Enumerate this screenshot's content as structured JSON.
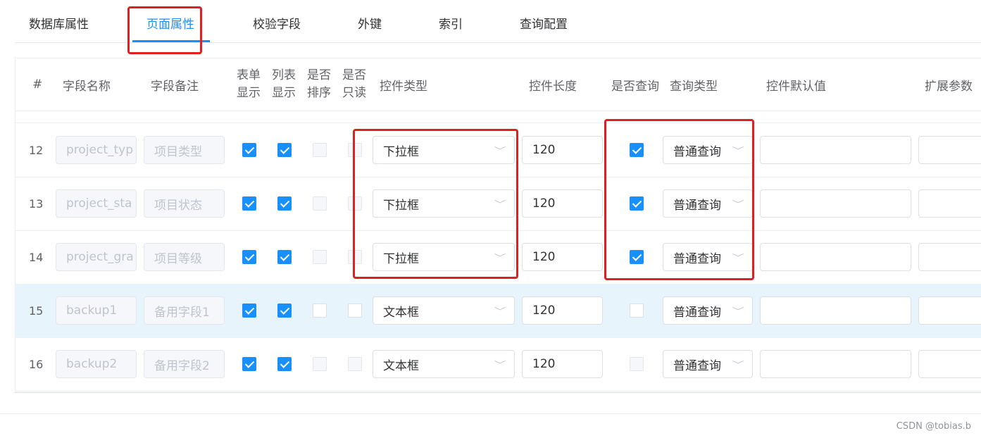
{
  "tabs": [
    {
      "label": "数据库属性",
      "active": false
    },
    {
      "label": "页面属性",
      "active": true
    },
    {
      "label": "校验字段",
      "active": false
    },
    {
      "label": "外键",
      "active": false
    },
    {
      "label": "索引",
      "active": false
    },
    {
      "label": "查询配置",
      "active": false
    }
  ],
  "table": {
    "headers": {
      "index": "#",
      "field_name": "字段名称",
      "field_remark": "字段备注",
      "form_show_1": "表单",
      "form_show_2": "显示",
      "list_show_1": "列表",
      "list_show_2": "显示",
      "sortable_1": "是否",
      "sortable_2": "排序",
      "readonly_1": "是否",
      "readonly_2": "只读",
      "control_type": "控件类型",
      "control_length": "控件长度",
      "is_query": "是否查询",
      "query_type": "查询类型",
      "default_value": "控件默认值",
      "ext_params": "扩展参数"
    },
    "rows": [
      {
        "index": "12",
        "field_name": "project_typ",
        "field_remark": "项目类型",
        "form_show": true,
        "list_show": true,
        "sortable": false,
        "readonly": false,
        "control_type": "下拉框",
        "control_length": "120",
        "is_query": true,
        "query_type": "普通查询",
        "default_value": "",
        "ext_params": ""
      },
      {
        "index": "13",
        "field_name": "project_sta",
        "field_remark": "项目状态",
        "form_show": true,
        "list_show": true,
        "sortable": false,
        "readonly": false,
        "control_type": "下拉框",
        "control_length": "120",
        "is_query": true,
        "query_type": "普通查询",
        "default_value": "",
        "ext_params": ""
      },
      {
        "index": "14",
        "field_name": "project_gra",
        "field_remark": "项目等级",
        "form_show": true,
        "list_show": true,
        "sortable": false,
        "readonly": false,
        "control_type": "下拉框",
        "control_length": "120",
        "is_query": true,
        "query_type": "普通查询",
        "default_value": "",
        "ext_params": ""
      },
      {
        "index": "15",
        "field_name": "backup1",
        "field_remark": "备用字段1",
        "form_show": true,
        "list_show": true,
        "sortable": false,
        "readonly": false,
        "control_type": "文本框",
        "control_length": "120",
        "is_query": false,
        "query_type": "普通查询",
        "default_value": "",
        "ext_params": ""
      },
      {
        "index": "16",
        "field_name": "backup2",
        "field_remark": "备用字段2",
        "form_show": true,
        "list_show": true,
        "sortable": false,
        "readonly": false,
        "control_type": "文本框",
        "control_length": "120",
        "is_query": false,
        "query_type": "普通查询",
        "default_value": "",
        "ext_params": ""
      }
    ]
  },
  "colors": {
    "accent": "#1890ff",
    "annotation": "#e02020",
    "row_highlight": "#e8f4fb"
  },
  "icons": {
    "select_arrow": "chevron-down-icon",
    "checked": "checkmark-icon"
  },
  "watermark": "CSDN @tobias.b"
}
